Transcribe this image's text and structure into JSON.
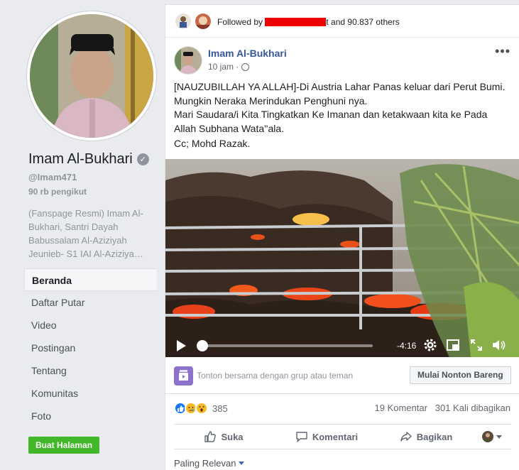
{
  "sidebar": {
    "page_name": "Imam Al-Bukhari",
    "handle": "@Imam471",
    "followers": "90 rb pengikut",
    "about": "(Fanspage Resmi) Imam Al-Bukhari, Santri Dayah Babussalam Al-Aziziyah Jeunieb- S1 IAI Al-Aziziya…",
    "nav": [
      {
        "label": "Beranda"
      },
      {
        "label": "Daftar Putar"
      },
      {
        "label": "Video"
      },
      {
        "label": "Postingan"
      },
      {
        "label": "Tentang"
      },
      {
        "label": "Komunitas"
      },
      {
        "label": "Foto"
      }
    ],
    "create_page_label": "Buat Halaman"
  },
  "post": {
    "followed_by_prefix": "Followed by",
    "followed_by_suffix": "t and 90.837 others",
    "author": "Imam Al-Bukhari",
    "time": "10 jam ·",
    "text_lines": [
      "[NAUZUBILLAH YA ALLAH]-Di Austria Lahar Panas keluar dari Perut Bumi.",
      "Mungkin Neraka Merindukan Penghuni nya.",
      "Mari Saudara/i Kita Tingkatkan Ke Imanan dan ketakwaan kita ke Pada",
      "Allah Subhana Wata''ala."
    ],
    "cc": "Cc; Mohd Razak.",
    "video": {
      "remaining": "-4:16",
      "progress": 0.0
    },
    "watch_party": {
      "text": "Tonton bersama dengan grup atau teman",
      "button": "Mulai Nonton Bareng"
    },
    "reaction_count": "385",
    "comments": "19 Komentar",
    "shares": "301 Kali dibagikan",
    "actions": {
      "like": "Suka",
      "comment": "Komentari",
      "share": "Bagikan"
    },
    "sort_label": "Paling Relevan"
  },
  "colors": {
    "link_blue": "#365899",
    "create_green": "#42b72a",
    "redaction": "#f00000"
  }
}
